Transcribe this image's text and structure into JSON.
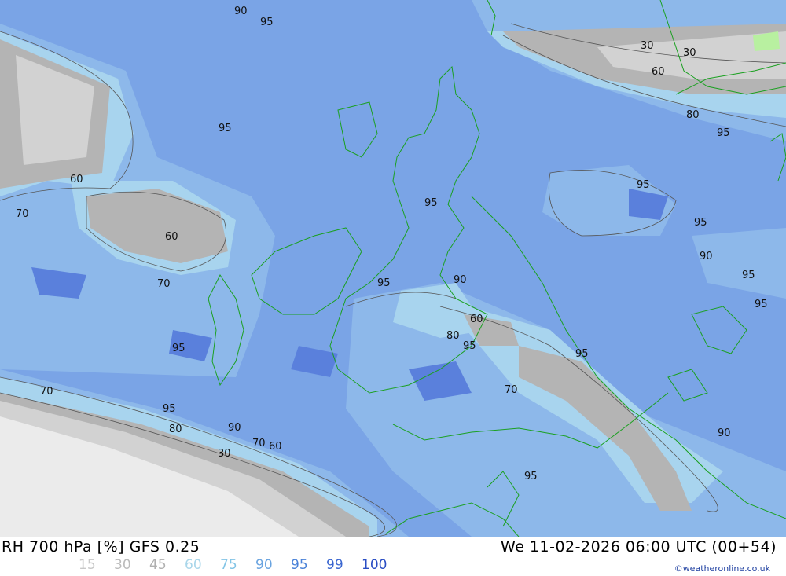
{
  "header": {
    "product": "RH 700 hPa [%] GFS 0.25",
    "valid_time": "We 11-02-2026 06:00 UTC (00+54)"
  },
  "legend": {
    "values": [
      {
        "label": "15",
        "color": "#c8c8c8"
      },
      {
        "label": "30",
        "color": "#bcbcbc"
      },
      {
        "label": "45",
        "color": "#b0b0b0"
      },
      {
        "label": "60",
        "color": "#a9d6ea"
      },
      {
        "label": "75",
        "color": "#82c4e6"
      },
      {
        "label": "90",
        "color": "#6aa4e0"
      },
      {
        "label": "95",
        "color": "#4a82d8"
      },
      {
        "label": "99",
        "color": "#3a66d0"
      },
      {
        "label": "100",
        "color": "#2a4ec4"
      }
    ]
  },
  "credit": "©weatheronline.co.uk",
  "contour_labels": [
    "90",
    "95",
    "30",
    "30",
    "60",
    "80",
    "95",
    "95",
    "60",
    "70",
    "60",
    "95",
    "95",
    "95",
    "95",
    "90",
    "95",
    "70",
    "90",
    "95",
    "95",
    "60",
    "80",
    "95",
    "95",
    "70",
    "95",
    "80",
    "90",
    "70",
    "60",
    "30",
    "90",
    "95"
  ]
}
